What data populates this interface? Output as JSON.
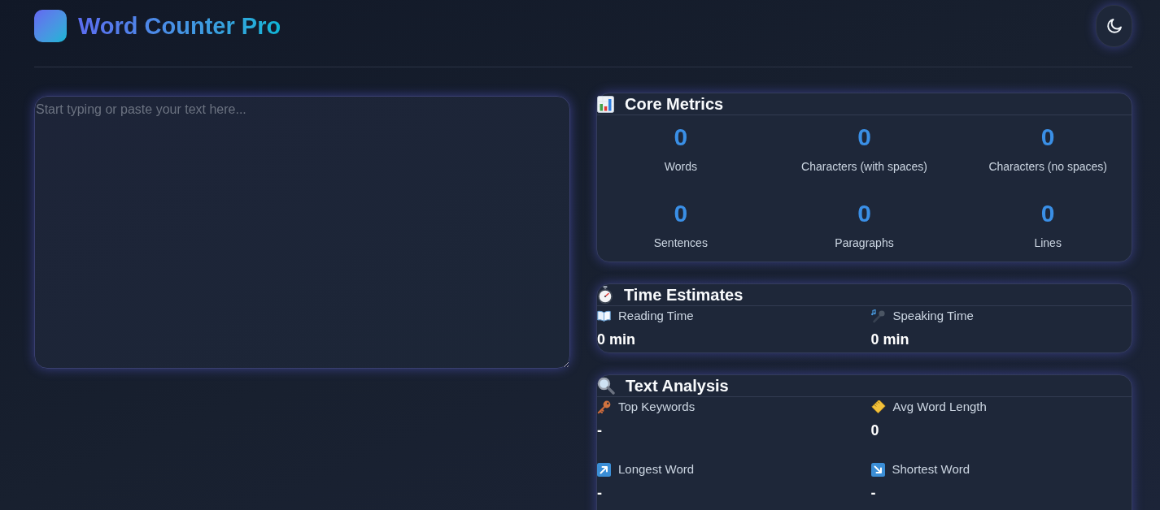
{
  "header": {
    "title": "Word Counter Pro"
  },
  "editor": {
    "placeholder": "Start typing or paste your text here..."
  },
  "core_metrics": {
    "title": "Core Metrics",
    "metrics": [
      {
        "value": "0",
        "label": "Words"
      },
      {
        "value": "0",
        "label": "Characters (with spaces)"
      },
      {
        "value": "0",
        "label": "Characters (no spaces)"
      },
      {
        "value": "0",
        "label": "Sentences"
      },
      {
        "value": "0",
        "label": "Paragraphs"
      },
      {
        "value": "0",
        "label": "Lines"
      }
    ]
  },
  "time_estimates": {
    "title": "Time Estimates",
    "items": [
      {
        "label": "Reading Time",
        "value": "0 min"
      },
      {
        "label": "Speaking Time",
        "value": "0 min"
      }
    ]
  },
  "text_analysis": {
    "title": "Text Analysis",
    "items": [
      {
        "label": "Top Keywords",
        "value": "-"
      },
      {
        "label": "Avg Word Length",
        "value": "0"
      },
      {
        "label": "Longest Word",
        "value": "-"
      },
      {
        "label": "Shortest Word",
        "value": "-"
      }
    ]
  }
}
